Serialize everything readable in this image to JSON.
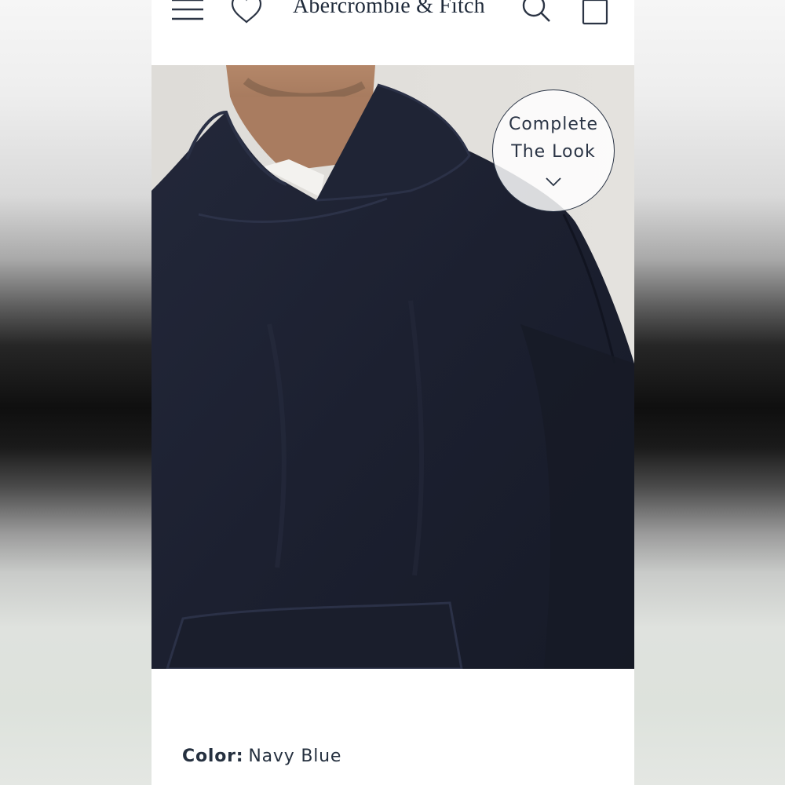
{
  "header": {
    "brand": "Abercrombie & Fitch",
    "icons": [
      "menu-icon",
      "heart-icon",
      "search-icon",
      "bag-icon"
    ]
  },
  "product": {
    "image_alt": "navy hoodie",
    "complete_the_look": {
      "line1": "Complete",
      "line2": "The Look",
      "icon": "chevron-down-icon"
    },
    "color_label": "Color:",
    "color_value": "Navy Blue"
  },
  "colors": {
    "navy": "#1c2030",
    "brand_text": "#1f2a3a"
  }
}
